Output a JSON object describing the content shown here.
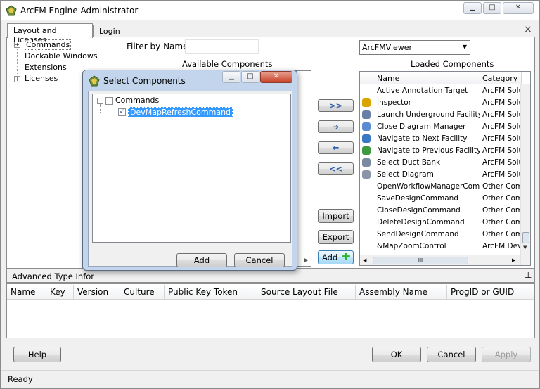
{
  "window": {
    "title": "ArcFM Engine Administrator",
    "controls": [
      "▁",
      "□",
      "✕"
    ]
  },
  "tabs": [
    "Layout and Licenses",
    "Login"
  ],
  "close_label": "×",
  "tree": {
    "items": [
      {
        "label": "Commands",
        "expandable": true
      },
      {
        "label": "Dockable Windows",
        "expandable": false
      },
      {
        "label": "Extensions",
        "expandable": false
      },
      {
        "label": "Licenses",
        "expandable": true
      }
    ]
  },
  "filter": {
    "label": "Filter by Name:",
    "value": ""
  },
  "available_label": "Available Components",
  "loaded": {
    "label": "Loaded Components",
    "dropdown_value": "ArcFMViewer",
    "columns": [
      "Name",
      "Category"
    ],
    "rows": [
      {
        "name": "Active Annotation Target",
        "category": "ArcFM Solu",
        "icon": "none"
      },
      {
        "name": "Inspector",
        "category": "ArcFM Solu",
        "icon": "inspector-icon"
      },
      {
        "name": "Launch Underground Facility...",
        "category": "ArcFM Solu",
        "icon": "underground-icon"
      },
      {
        "name": "Close Diagram Manager",
        "category": "ArcFM Solu",
        "icon": "diagram-icon"
      },
      {
        "name": "Navigate to Next Facility",
        "category": "ArcFM Solu",
        "icon": "nav-next-icon"
      },
      {
        "name": "Navigate to Previous Facility",
        "category": "ArcFM Solu",
        "icon": "nav-prev-icon"
      },
      {
        "name": "Select Duct Bank",
        "category": "ArcFM Solu",
        "icon": "select-duct-icon"
      },
      {
        "name": "Select Diagram",
        "category": "ArcFM Solu",
        "icon": "select-diagram-icon"
      },
      {
        "name": "OpenWorkflowManagerCom...",
        "category": "Other Comr",
        "icon": "none"
      },
      {
        "name": "SaveDesignCommand",
        "category": "Other Comr",
        "icon": "none"
      },
      {
        "name": "CloseDesignCommand",
        "category": "Other Comr",
        "icon": "none"
      },
      {
        "name": "DeleteDesignCommand",
        "category": "Other Comr",
        "icon": "none"
      },
      {
        "name": "SendDesignCommand",
        "category": "Other Comr",
        "icon": "none"
      },
      {
        "name": "&MapZoomControl",
        "category": "ArcFM Deve",
        "icon": "none"
      }
    ]
  },
  "move_buttons": [
    ">>",
    "➔",
    "⬅",
    "<<"
  ],
  "side_buttons": {
    "import": "Import",
    "export": "Export",
    "add": "Add"
  },
  "scroll_grip": "III",
  "advanced": {
    "label": "Advanced Type Infor",
    "pin": "⊥",
    "columns": [
      "Name",
      "Key",
      "Version",
      "Culture",
      "Public Key Token",
      "Source Layout File",
      "Assembly Name",
      "ProgID or GUID"
    ]
  },
  "bottom_buttons": {
    "help": "Help",
    "ok": "OK",
    "cancel": "Cancel",
    "apply": "Apply"
  },
  "status": "Ready",
  "dialog": {
    "title": "Select Components",
    "controls": [
      "▁",
      "□",
      "✕"
    ],
    "tree_root": "Commands",
    "tree_child": "DevMapRefreshCommand",
    "add": "Add",
    "cancel": "Cancel"
  },
  "colors": {
    "selection": "#3399ff",
    "add_plus": "#2db52d"
  }
}
